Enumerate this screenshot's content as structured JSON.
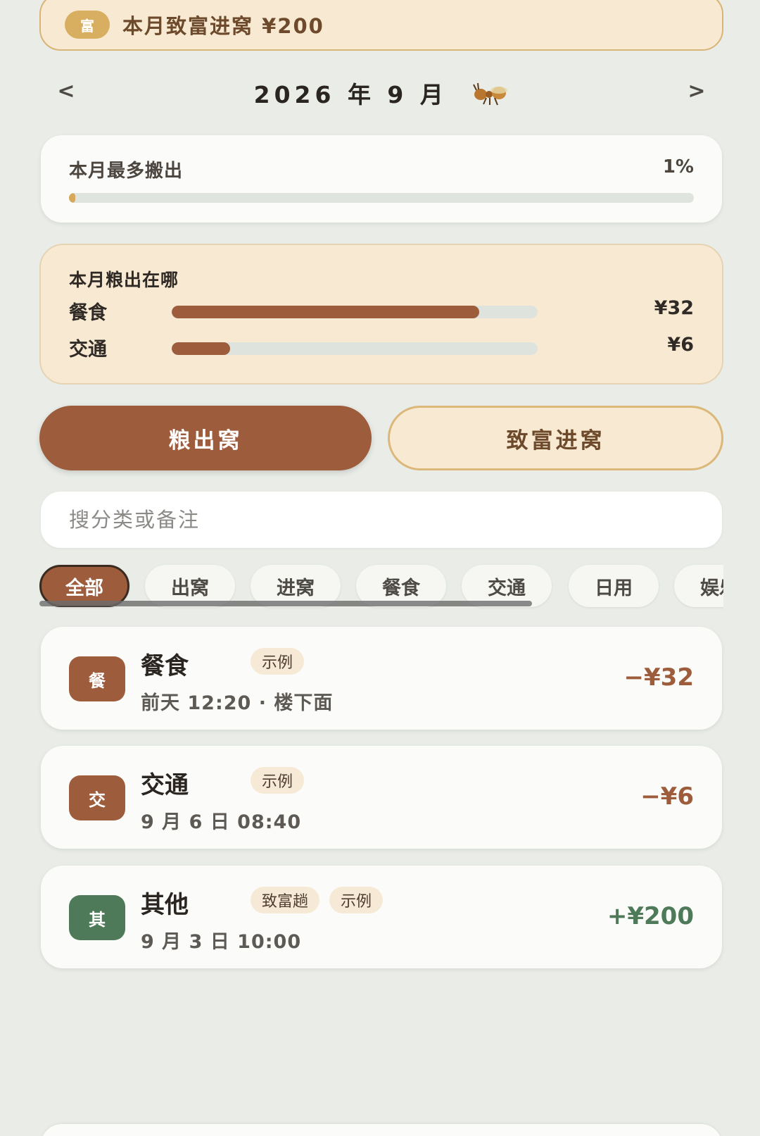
{
  "banner": {
    "badge": "富",
    "text": "本月致富进窝 ¥200"
  },
  "month_nav": {
    "prev": "<",
    "title": "2026 年 9 月",
    "next": ">"
  },
  "max_card": {
    "label": "本月最多搬出",
    "percent_text": "1%",
    "percent_value": 0.01
  },
  "breakdown": {
    "title": "本月粮出在哪",
    "rows": [
      {
        "name": "餐食",
        "amount": "¥32",
        "ratio": 0.84
      },
      {
        "name": "交通",
        "amount": "¥6",
        "ratio": 0.16
      }
    ]
  },
  "toggle": {
    "out_label": "粮出窝",
    "in_label": "致富进窝"
  },
  "search": {
    "placeholder": "搜分类或备注",
    "value": ""
  },
  "chips": [
    "全部",
    "出窝",
    "进窝",
    "餐食",
    "交通",
    "日用",
    "娱乐"
  ],
  "chips_active": "全部",
  "transactions": [
    {
      "icon": "餐",
      "title": "餐食",
      "tags": [
        "示例"
      ],
      "subtitle": "前天 12:20 · 楼下面",
      "amount": "−¥32",
      "kind": "expense",
      "icon_color": "#9d5c3c"
    },
    {
      "icon": "交",
      "title": "交通",
      "tags": [
        "示例"
      ],
      "subtitle": "9 月 6 日 08:40",
      "amount": "−¥6",
      "kind": "expense",
      "icon_color": "#9d5c3c"
    },
    {
      "icon": "其",
      "title": "其他",
      "tags": [
        "致富趟",
        "示例"
      ],
      "subtitle": "9 月 3 日 10:00",
      "amount": "+¥200",
      "kind": "income",
      "icon_color": "#4e7a59"
    }
  ],
  "colors": {
    "accent_brown": "#9d5c3c",
    "income_green": "#4e7a59",
    "cream": "#f8ead2",
    "gold": "#d8ae61"
  },
  "icons": {
    "ant": "ant-icon",
    "prev": "chevron-left-icon",
    "next": "chevron-right-icon"
  }
}
